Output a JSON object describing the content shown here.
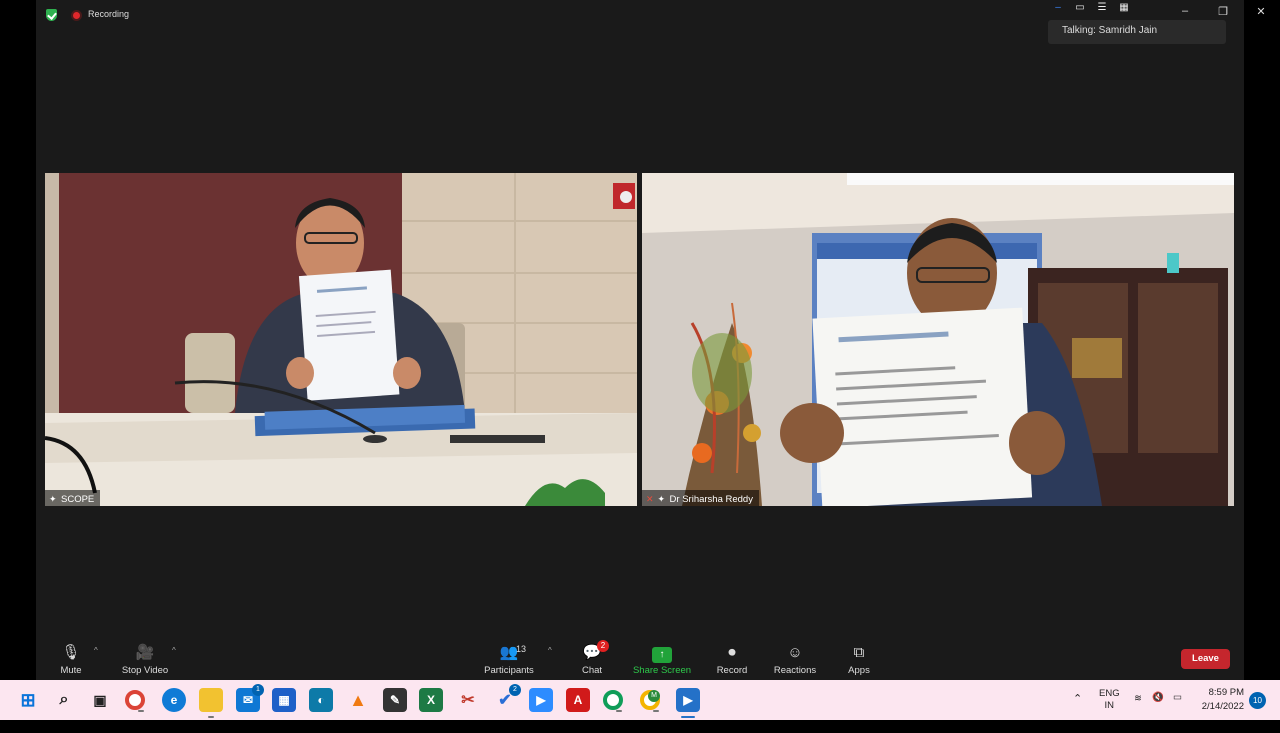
{
  "top": {
    "recording_label": "Recording",
    "talking_label": "Talking: Samridh Jain"
  },
  "window_controls": [
    "–",
    "❐",
    "✕"
  ],
  "view_icons": [
    "–",
    "▭",
    "☰",
    "▦"
  ],
  "videos": {
    "left": {
      "name": "SCOPE"
    },
    "right": {
      "name": "Dr Sriharsha Reddy"
    }
  },
  "toolbar": {
    "mute": "Mute",
    "stop_video": "Stop Video",
    "participants": "Participants",
    "participants_count": "13",
    "chat": "Chat",
    "chat_badge": "2",
    "share_screen": "Share Screen",
    "record": "Record",
    "reactions": "Reactions",
    "apps": "Apps",
    "leave": "Leave"
  },
  "taskbar": {
    "mail_badge": "1",
    "todo_badge": "2",
    "chrome_badge": "M",
    "lang_top": "ENG",
    "lang_bottom": "IN",
    "time": "8:59 PM",
    "date": "2/14/2022",
    "notifications": "10"
  },
  "colors": {
    "leave": "#c5262d",
    "share": "#21a33a",
    "recording": "#e0272b",
    "taskbar": "#fce6f0"
  }
}
